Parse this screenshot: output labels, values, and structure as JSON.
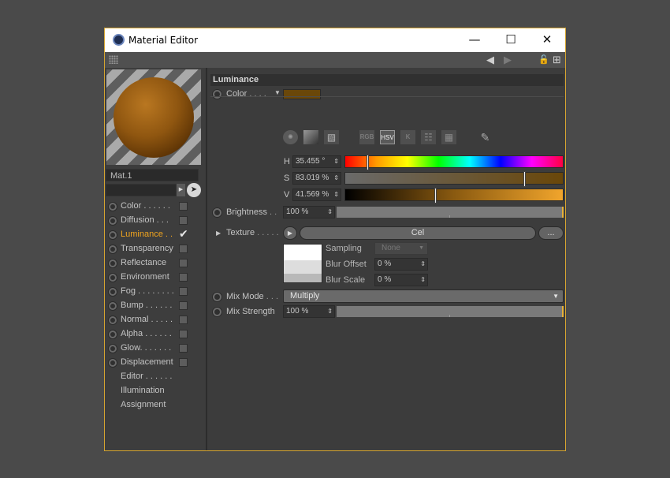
{
  "window": {
    "title": "Material Editor",
    "minimize": "—",
    "maximize": "☐",
    "close": "✕"
  },
  "toolbar": {
    "back": "◀",
    "forward": "▶",
    "lock": "🔓",
    "new": "⊞"
  },
  "material": {
    "name": "Mat.1"
  },
  "channels": [
    {
      "label": "Color . . . . . .",
      "active": false,
      "checked": false,
      "has_checkbox": true
    },
    {
      "label": "Diffusion . . .",
      "active": false,
      "checked": false,
      "has_checkbox": true
    },
    {
      "label": "Luminance . .",
      "active": true,
      "checked": true,
      "has_checkbox": true
    },
    {
      "label": "Transparency",
      "active": false,
      "checked": false,
      "has_checkbox": true
    },
    {
      "label": "Reflectance",
      "active": false,
      "checked": false,
      "has_checkbox": true
    },
    {
      "label": "Environment",
      "active": false,
      "checked": false,
      "has_checkbox": true
    },
    {
      "label": "Fog . . . . . . . .",
      "active": false,
      "checked": false,
      "has_checkbox": true
    },
    {
      "label": "Bump . . . . . .",
      "active": false,
      "checked": false,
      "has_checkbox": true
    },
    {
      "label": "Normal . . . . .",
      "active": false,
      "checked": false,
      "has_checkbox": true
    },
    {
      "label": "Alpha . . . . . .",
      "active": false,
      "checked": false,
      "has_checkbox": true
    },
    {
      "label": "Glow. . . . . . .",
      "active": false,
      "checked": false,
      "has_checkbox": true
    },
    {
      "label": "Displacement",
      "active": false,
      "checked": false,
      "has_checkbox": true
    },
    {
      "label": "Editor . . . . . .",
      "active": false,
      "checked": false,
      "has_checkbox": false
    },
    {
      "label": "Illumination",
      "active": false,
      "checked": false,
      "has_checkbox": false
    },
    {
      "label": "Assignment",
      "active": false,
      "checked": false,
      "has_checkbox": false
    }
  ],
  "section": {
    "title": "Luminance"
  },
  "color": {
    "label": "Color",
    "dots": " . . . .",
    "swatch": "#6a4709",
    "modes": [
      "RGB",
      "HSV",
      "K"
    ],
    "selected_mode": "HSV",
    "h": {
      "label": "H",
      "value": "35.455 °",
      "fraction": 0.0985
    },
    "s": {
      "label": "S",
      "value": "83.019 %",
      "fraction": 0.83019
    },
    "v": {
      "label": "V",
      "value": "41.569 %",
      "fraction": 0.41569
    }
  },
  "brightness": {
    "label": "Brightness",
    "dots": " . .",
    "value": "100 %",
    "fraction": 1.0
  },
  "texture": {
    "label": "Texture",
    "dots": " . . . . .",
    "shader": "Cel",
    "more": "...",
    "sampling_label": "Sampling",
    "sampling_value": "None",
    "blur_offset_label": "Blur Offset",
    "blur_offset_value": "0 %",
    "blur_scale_label": "Blur Scale",
    "blur_scale_value": "0 %"
  },
  "mix_mode": {
    "label": "Mix Mode",
    "dots": ". . .",
    "value": "Multiply"
  },
  "mix_strength": {
    "label": "Mix Strength",
    "value": "100 %",
    "fraction": 1.0
  },
  "colors": {
    "accent": "#f0a41e",
    "window_border": "#d6a530",
    "panel": "#3c3c3c"
  }
}
